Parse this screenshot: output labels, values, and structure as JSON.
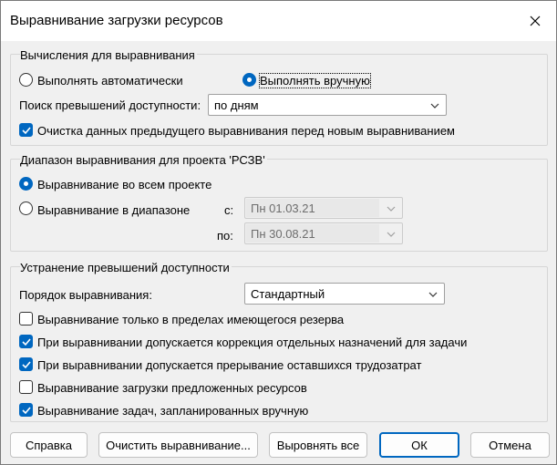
{
  "window": {
    "title": "Выравнивание загрузки ресурсов",
    "close_icon": "close-icon"
  },
  "calc_group": {
    "title": "Вычисления для выравнивания",
    "auto_label": "Выполнять автоматически",
    "manual_label": "Выполнять вручную",
    "selected": "manual",
    "search_label": "Поиск превышений доступности:",
    "search_value": "по дням",
    "clear_label": "Очистка данных предыдущего выравнивания перед новым выравниванием",
    "clear_checked": true
  },
  "range_group": {
    "title": "Диапазон выравнивания для проекта 'РСЗВ'",
    "all_label": "Выравнивание во всем проекте",
    "range_label": "Выравнивание в диапазоне",
    "selected": "all",
    "from_label": "с:",
    "from_value": "Пн 01.03.21",
    "to_label": "по:",
    "to_value": "Пн 30.08.21"
  },
  "resolve_group": {
    "title": "Устранение превышений доступности",
    "order_label": "Порядок выравнивания:",
    "order_value": "Стандартный",
    "options": [
      {
        "label": "Выравнивание только в пределах имеющегося резерва",
        "checked": false
      },
      {
        "label": "При выравнивании допускается коррекция отдельных назначений для задачи",
        "checked": true
      },
      {
        "label": "При выравнивании допускается прерывание оставшихся трудозатрат",
        "checked": true
      },
      {
        "label": "Выравнивание загрузки предложенных ресурсов",
        "checked": false
      },
      {
        "label": "Выравнивание задач, запланированных вручную",
        "checked": true
      }
    ]
  },
  "buttons": {
    "help": "Справка",
    "clear": "Очистить выравнивание...",
    "level_all": "Выровнять все",
    "ok": "ОК",
    "cancel": "Отмена"
  },
  "colors": {
    "accent": "#0067c0",
    "dialog_bg": "#f0f0f0",
    "title_bg": "#ffffff"
  }
}
